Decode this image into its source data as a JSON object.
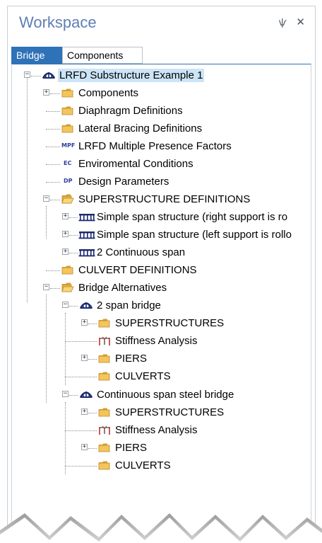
{
  "panel": {
    "title": "Workspace",
    "pin_glyph": "ѱ",
    "close_glyph": "✕"
  },
  "tabs": [
    {
      "label": "Bridge",
      "active": true
    },
    {
      "label": "Components",
      "active": false
    }
  ],
  "tree": {
    "root": "LRFD Substructure Example 1",
    "components": "Components",
    "diaphragm": "Diaphragm Definitions",
    "lateral_bracing": "Lateral Bracing Definitions",
    "mpf_icon": "MPF",
    "mpf": "LRFD Multiple Presence Factors",
    "ec_icon": "EC",
    "env": "Enviromental Conditions",
    "dp_icon": "DP",
    "design_params": "Design Parameters",
    "superstructure_defs": "SUPERSTRUCTURE DEFINITIONS",
    "sd1": "Simple span structure (right support is ro",
    "sd2": "Simple span structure (left support is rollo",
    "sd3": "2 Continuous span",
    "culvert_defs": "CULVERT DEFINITIONS",
    "alternatives": "Bridge Alternatives",
    "bridge1": {
      "name": "2 span bridge",
      "superstructures": "SUPERSTRUCTURES",
      "stiffness": "Stiffness Analysis",
      "piers": "PIERS",
      "culverts": "CULVERTS"
    },
    "bridge2": {
      "name": "Continuous span steel bridge",
      "superstructures": "SUPERSTRUCTURES",
      "stiffness": "Stiffness Analysis",
      "piers": "PIERS",
      "culverts": "CULVERTS"
    }
  },
  "colors": {
    "tab_active": "#2f72b8",
    "title": "#5f7fb8",
    "selection": "#cce4f7",
    "folder": "#e8b94a"
  }
}
